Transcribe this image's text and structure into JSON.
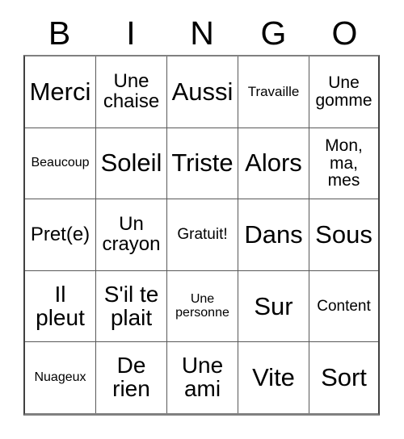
{
  "card": {
    "title_letters": [
      "B",
      "I",
      "N",
      "G",
      "O"
    ],
    "columns": 5,
    "rows": 5,
    "colors": {
      "background": "#ffffff",
      "text": "#000000",
      "grid_line": "#595959",
      "outer_border": "#808080"
    },
    "cells": [
      [
        {
          "text": "Merci",
          "size": "fs-xl"
        },
        {
          "text": "Une\nchaise",
          "size": "fs-md"
        },
        {
          "text": "Aussi",
          "size": "fs-xl"
        },
        {
          "text": "Travaille",
          "size": "fs-xxs"
        },
        {
          "text": "Une\ngomme",
          "size": "fs-sm"
        }
      ],
      [
        {
          "text": "Beaucoup",
          "size": "fs-tiny"
        },
        {
          "text": "Soleil",
          "size": "fs-xl"
        },
        {
          "text": "Triste",
          "size": "fs-xl"
        },
        {
          "text": "Alors",
          "size": "fs-xl"
        },
        {
          "text": "Mon,\nma,\nmes",
          "size": "fs-sm"
        }
      ],
      [
        {
          "text": "Pret(e)",
          "size": "fs-md"
        },
        {
          "text": "Un\ncrayon",
          "size": "fs-md"
        },
        {
          "text": "Gratuit!",
          "size": "fs-xs"
        },
        {
          "text": "Dans",
          "size": "fs-xl"
        },
        {
          "text": "Sous",
          "size": "fs-xl"
        }
      ],
      [
        {
          "text": "Il\npleut",
          "size": "fs-lg"
        },
        {
          "text": "S'il te\nplait",
          "size": "fs-lg"
        },
        {
          "text": "Une\npersonne",
          "size": "fs-tiny"
        },
        {
          "text": "Sur",
          "size": "fs-xl"
        },
        {
          "text": "Content",
          "size": "fs-xs"
        }
      ],
      [
        {
          "text": "Nuageux",
          "size": "fs-tiny"
        },
        {
          "text": "De\nrien",
          "size": "fs-lg"
        },
        {
          "text": "Une\nami",
          "size": "fs-lg"
        },
        {
          "text": "Vite",
          "size": "fs-xl"
        },
        {
          "text": "Sort",
          "size": "fs-xl"
        }
      ]
    ]
  }
}
